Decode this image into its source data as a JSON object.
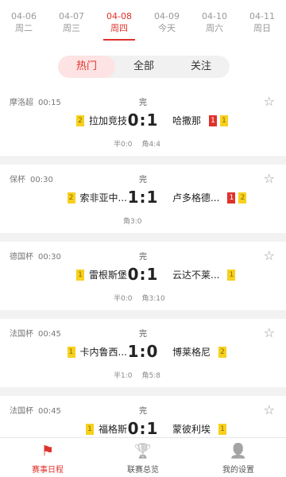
{
  "dates": [
    {
      "date": "04-06",
      "weekday": "周二",
      "active": false
    },
    {
      "date": "04-07",
      "weekday": "周三",
      "active": false
    },
    {
      "date": "04-08",
      "weekday": "周四",
      "active": true
    },
    {
      "date": "04-09",
      "weekday": "今天",
      "active": false
    },
    {
      "date": "04-10",
      "weekday": "周六",
      "active": false
    },
    {
      "date": "04-11",
      "weekday": "周日",
      "active": false
    }
  ],
  "tabs": [
    "热门",
    "全部",
    "关注"
  ],
  "active_tab": 0,
  "matches": [
    {
      "league": "摩洛超",
      "time": "00:15",
      "status": "完",
      "home": "拉加竞技",
      "away": "哈撒那",
      "score": "0:1",
      "home_cards": [
        {
          "type": "yellow",
          "n": "2"
        }
      ],
      "away_cards": [
        {
          "type": "red",
          "n": "1"
        },
        {
          "type": "yellow",
          "n": "1"
        }
      ],
      "half": "半0:0",
      "corner": "角4:4"
    },
    {
      "league": "保杯",
      "time": "00:30",
      "status": "完",
      "home": "索非亚中...",
      "away": "卢多格德...",
      "score": "1:1",
      "home_cards": [
        {
          "type": "yellow",
          "n": "2"
        }
      ],
      "away_cards": [
        {
          "type": "red",
          "n": "1"
        },
        {
          "type": "yellow",
          "n": "2"
        }
      ],
      "half": "",
      "corner": "角3:0"
    },
    {
      "league": "德国杯",
      "time": "00:30",
      "status": "完",
      "home": "雷根斯堡",
      "away": "云达不莱...",
      "score": "0:1",
      "home_cards": [
        {
          "type": "yellow",
          "n": "1"
        }
      ],
      "away_cards": [
        {
          "type": "yellow",
          "n": "1"
        }
      ],
      "half": "半0:0",
      "corner": "角3:10"
    },
    {
      "league": "法国杯",
      "time": "00:45",
      "status": "完",
      "home": "卡内鲁西...",
      "away": "博莱格尼",
      "score": "1:0",
      "home_cards": [
        {
          "type": "yellow",
          "n": "1"
        }
      ],
      "away_cards": [
        {
          "type": "yellow",
          "n": "2"
        }
      ],
      "half": "半1:0",
      "corner": "角5:8"
    },
    {
      "league": "法国杯",
      "time": "00:45",
      "status": "完",
      "home": "福格斯",
      "away": "蒙彼利埃",
      "score": "0:1",
      "home_cards": [
        {
          "type": "yellow",
          "n": "1"
        }
      ],
      "away_cards": [
        {
          "type": "yellow",
          "n": "1"
        }
      ],
      "half": "",
      "corner": ""
    }
  ],
  "bottom_tabs": [
    {
      "label": "赛事日程",
      "icon": "flag-icon",
      "active": true
    },
    {
      "label": "联赛总览",
      "icon": "trophy-icon",
      "active": false
    },
    {
      "label": "我的设置",
      "icon": "user-icon",
      "active": false
    }
  ],
  "colors": {
    "accent": "#e0322d",
    "yellow_card": "#f7d11e",
    "red_card": "#e0322d"
  }
}
